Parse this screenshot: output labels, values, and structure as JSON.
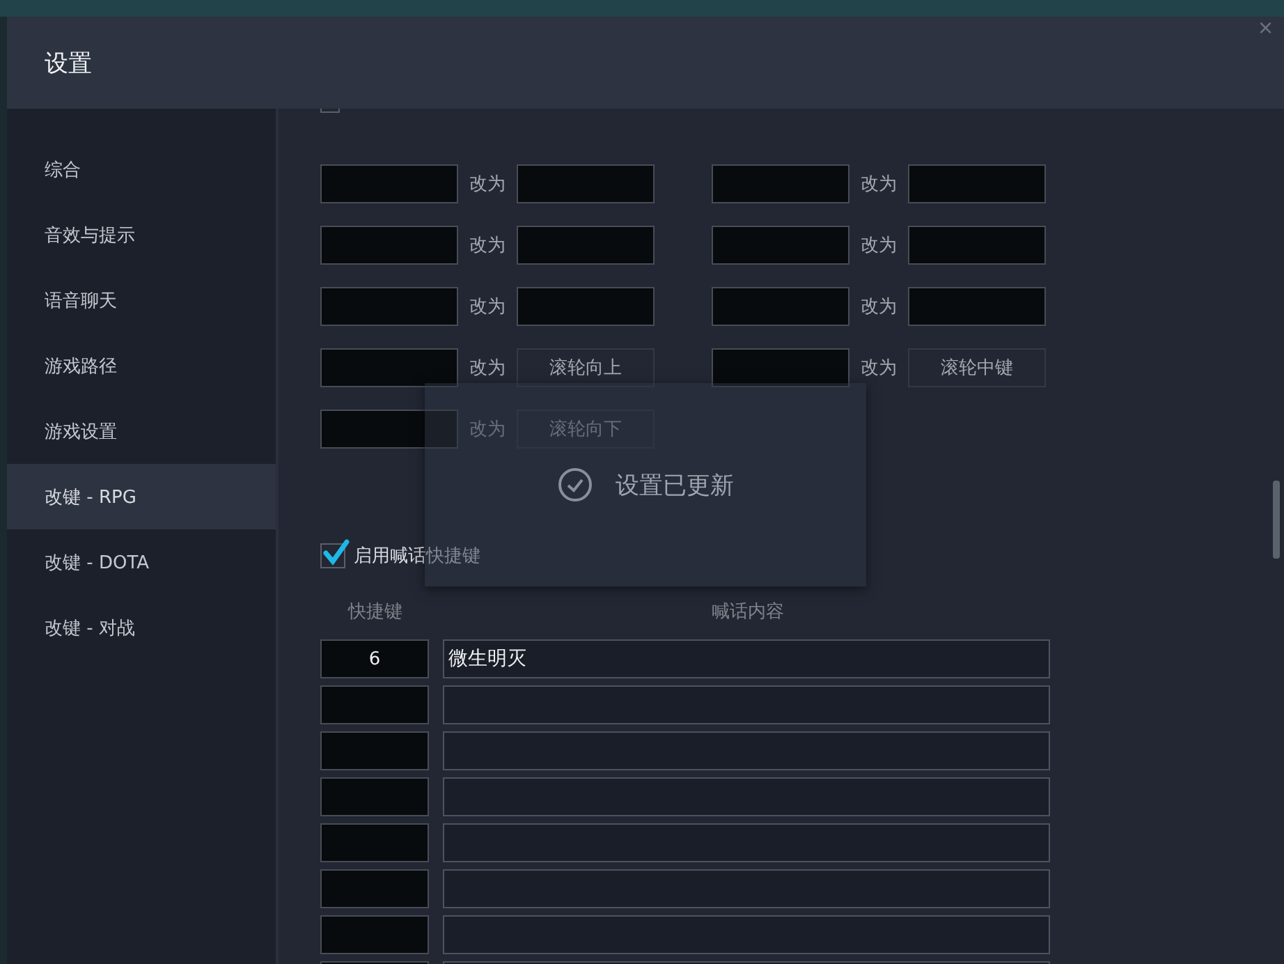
{
  "window": {
    "title": "设置",
    "close": "×"
  },
  "sidebar": {
    "items": [
      {
        "label": "综合",
        "selected": false
      },
      {
        "label": "音效与提示",
        "selected": false
      },
      {
        "label": "语音聊天",
        "selected": false
      },
      {
        "label": "游戏路径",
        "selected": false
      },
      {
        "label": "游戏设置",
        "selected": false
      },
      {
        "label": "改键 - RPG",
        "selected": true
      },
      {
        "label": "改键 - DOTA",
        "selected": false
      },
      {
        "label": "改键 - 对战",
        "selected": false
      }
    ]
  },
  "key_remap": {
    "rows": [
      {
        "left": {
          "kind": "field",
          "label": "改为"
        },
        "right": {
          "kind": "field",
          "label": "改为"
        }
      },
      {
        "left": {
          "kind": "field",
          "label": "改为"
        },
        "right": {
          "kind": "field",
          "label": "改为"
        }
      },
      {
        "left": {
          "kind": "field",
          "label": "改为"
        },
        "right": {
          "kind": "field",
          "label": "改为"
        }
      },
      {
        "left": {
          "kind": "preset",
          "label": "改为",
          "value": "滚轮向上"
        },
        "right": {
          "kind": "preset",
          "label": "改为",
          "value": "滚轮中键"
        }
      },
      {
        "left": {
          "kind": "preset",
          "label": "改为",
          "value": "滚轮向下"
        }
      }
    ]
  },
  "shout": {
    "enable": {
      "label": "启用喊话快捷键",
      "checked": true
    },
    "columns": [
      "快捷键",
      "喊话内容"
    ],
    "rows": [
      {
        "key": "6",
        "text": "微生明灭"
      },
      {},
      {},
      {},
      {},
      {},
      {},
      {}
    ]
  },
  "toast": {
    "message": "设置已更新"
  }
}
